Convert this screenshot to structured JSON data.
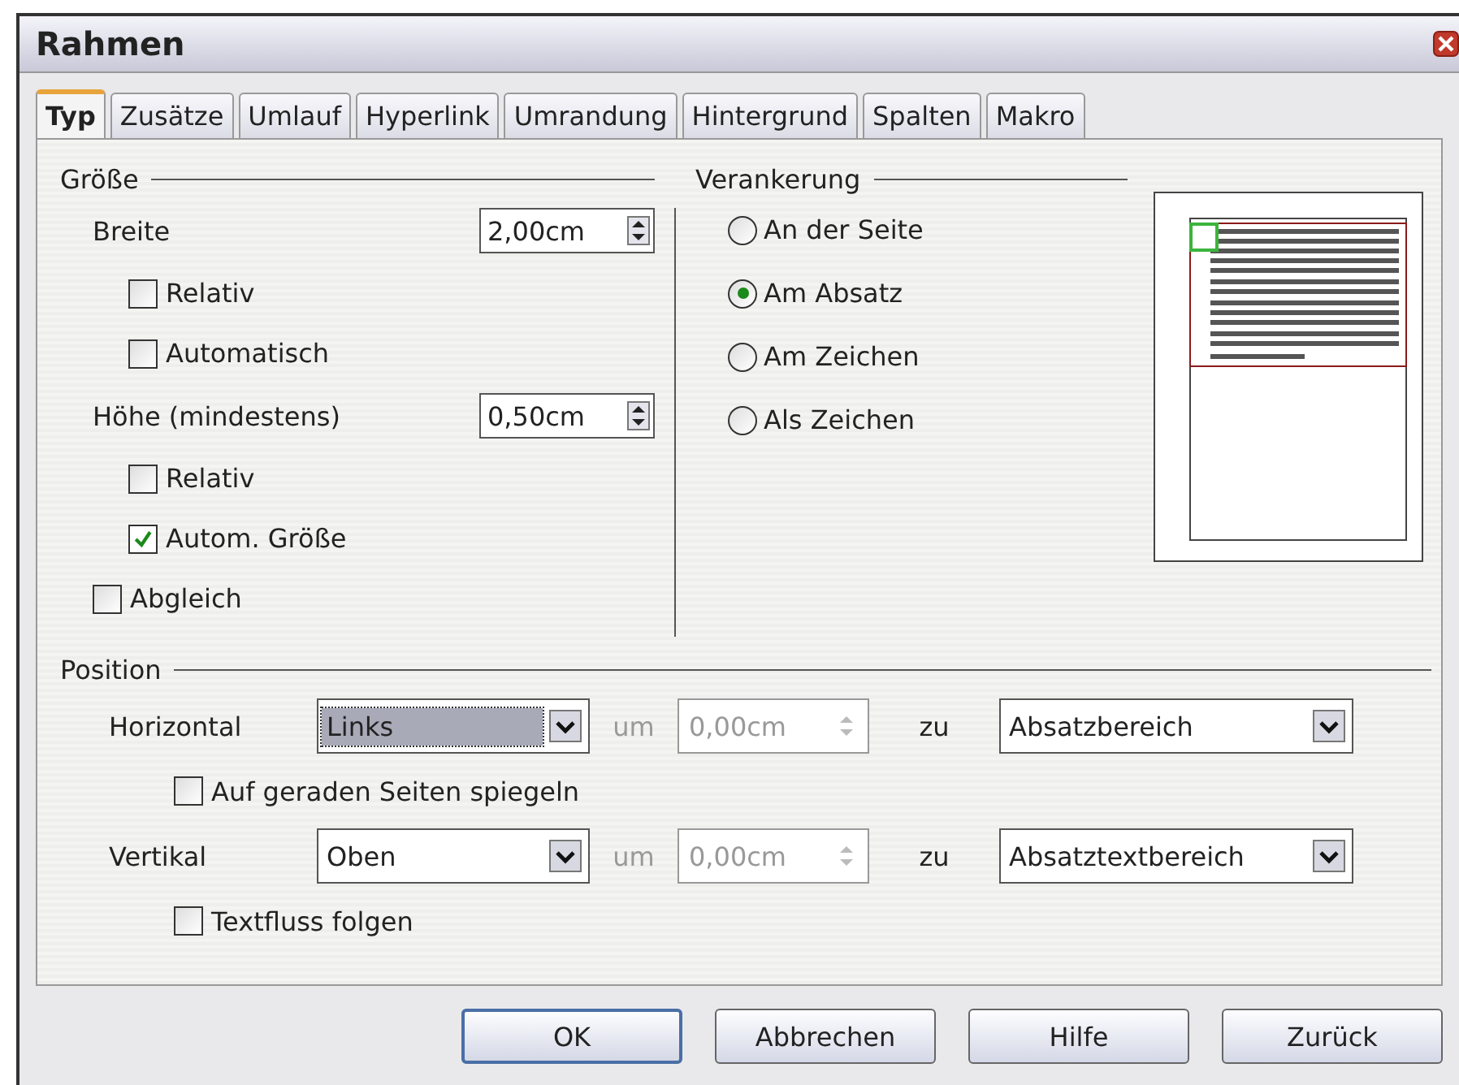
{
  "window": {
    "title": "Rahmen"
  },
  "tabs": [
    {
      "label": "Typ",
      "selected": true
    },
    {
      "label": "Zusätze",
      "selected": false
    },
    {
      "label": "Umlauf",
      "selected": false
    },
    {
      "label": "Hyperlink",
      "selected": false
    },
    {
      "label": "Umrandung",
      "selected": false
    },
    {
      "label": "Hintergrund",
      "selected": false
    },
    {
      "label": "Spalten",
      "selected": false
    },
    {
      "label": "Makro",
      "selected": false
    }
  ],
  "size": {
    "title": "Größe",
    "width": {
      "label": "Breite",
      "value": "2,00cm"
    },
    "width_options": [
      {
        "label": "Relativ",
        "checked": false
      },
      {
        "label": "Automatisch",
        "checked": false
      }
    ],
    "height": {
      "label": "Höhe (mindestens)",
      "value": "0,50cm"
    },
    "height_options": [
      {
        "label": "Relativ",
        "checked": false
      },
      {
        "label": "Autom. Größe",
        "checked": true
      }
    ],
    "match": {
      "label": "Abgleich",
      "checked": false
    }
  },
  "anchor": {
    "title": "Verankerung",
    "options": [
      {
        "label": "An der Seite",
        "selected": false
      },
      {
        "label": "Am Absatz",
        "selected": true
      },
      {
        "label": "Am Zeichen",
        "selected": false
      },
      {
        "label": "Als Zeichen",
        "selected": false
      }
    ]
  },
  "position": {
    "title": "Position",
    "rows": [
      {
        "label": "Horizontal",
        "value": "Links",
        "focused": true,
        "by_label": "um",
        "by_value": "0,00cm",
        "by_disabled": true,
        "to_label": "zu",
        "to_value": "Absatzbereich",
        "option": {
          "label": "Auf geraden Seiten spiegeln",
          "checked": false
        }
      },
      {
        "label": "Vertikal",
        "value": "Oben",
        "focused": false,
        "by_label": "um",
        "by_value": "0,00cm",
        "by_disabled": true,
        "to_label": "zu",
        "to_value": "Absatztextbereich",
        "option": {
          "label": "Textfluss folgen",
          "checked": false
        }
      }
    ]
  },
  "buttons": [
    {
      "label": "OK",
      "default": true
    },
    {
      "label": "Abbrechen",
      "default": false
    },
    {
      "label": "Hilfe",
      "default": false
    },
    {
      "label": "Zurück",
      "default": false
    }
  ]
}
